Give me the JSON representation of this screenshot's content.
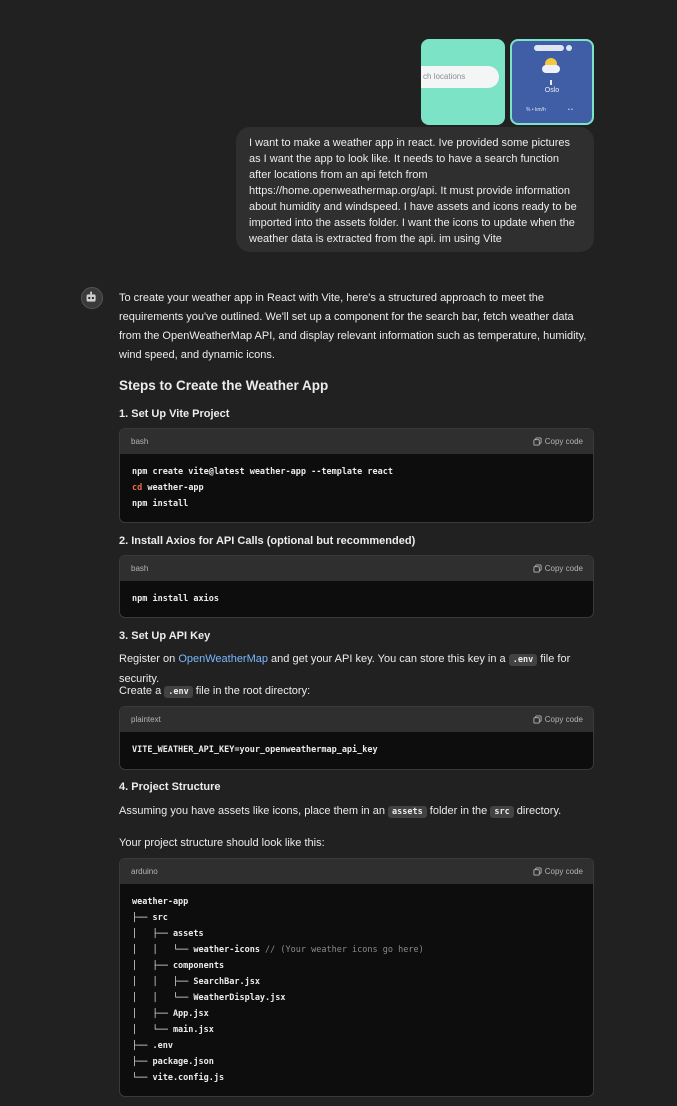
{
  "user_message": {
    "attachments": [
      {
        "name": "search-screenshot",
        "search_placeholder": "ch locations"
      },
      {
        "name": "weather-screenshot",
        "city": "Oslo",
        "stats": [
          "% • km/h",
          "• •"
        ]
      }
    ],
    "text": "I want to make a weather app in react. Ive provided some pictures as I want the app to look like. It needs to have a search function after locations from an api fetch from https://home.openweathermap.org/api. It must provide information about humidity and windspeed. I have assets and icons ready to be imported into the assets folder. I want the icons to update when the weather data is extracted from the api.  im using Vite"
  },
  "assistant": {
    "intro": "To create your weather app in React with Vite, here's a structured approach to meet the requirements you've outlined. We'll set up a component for the search bar, fetch weather data from the OpenWeatherMap API, and display relevant information such as temperature, humidity, wind speed, and dynamic icons.",
    "heading": "Steps to Create the Weather App",
    "copy_label": "Copy code",
    "step1": {
      "title": "1. Set Up Vite Project",
      "lang": "bash",
      "lines": [
        "npm create vite@latest weather-app --template react",
        "weather-app",
        "npm install"
      ],
      "cd": "cd"
    },
    "step2": {
      "title": "2. Install Axios for API Calls (optional but recommended)",
      "lang": "bash",
      "code": "npm install axios"
    },
    "step3": {
      "title": "3. Set Up API Key",
      "text_before": "Register on ",
      "link": "OpenWeatherMap",
      "text_mid": " and get your API key. You can store this key in a ",
      "code_env": ".env",
      "text_after": " file for security.",
      "create_before": "Create a ",
      "create_after": " file in the root directory:",
      "lang": "plaintext",
      "code": "VITE_WEATHER_API_KEY=your_openweathermap_api_key"
    },
    "step4": {
      "title": "4. Project Structure",
      "text_before": "Assuming you have assets like icons, place them in an ",
      "code_assets": "assets",
      "text_mid": " folder in the ",
      "code_src": "src",
      "text_after": " directory.",
      "structure_intro": "Your project structure should look like this:",
      "lang": "arduino",
      "tree": [
        "weather-app",
        "├── src",
        "│   ├── assets",
        "│   │   └── weather-icons",
        "│   ├── components",
        "│   │   ├── SearchBar.jsx",
        "│   │   └── WeatherDisplay.jsx",
        "│   ├── App.jsx",
        "│   └── main.jsx",
        "├── .env",
        "├── package.json",
        "└── vite.config.js"
      ],
      "tree_comment": " // (Your weather icons go here)"
    }
  },
  "colors": {
    "background": "#212121",
    "bubble": "#2f2f2f",
    "code_bg": "#0d0d0d",
    "link": "#7ab7ff",
    "keyword": "#f06b4a",
    "attachment_accent": "#7de3c6"
  }
}
